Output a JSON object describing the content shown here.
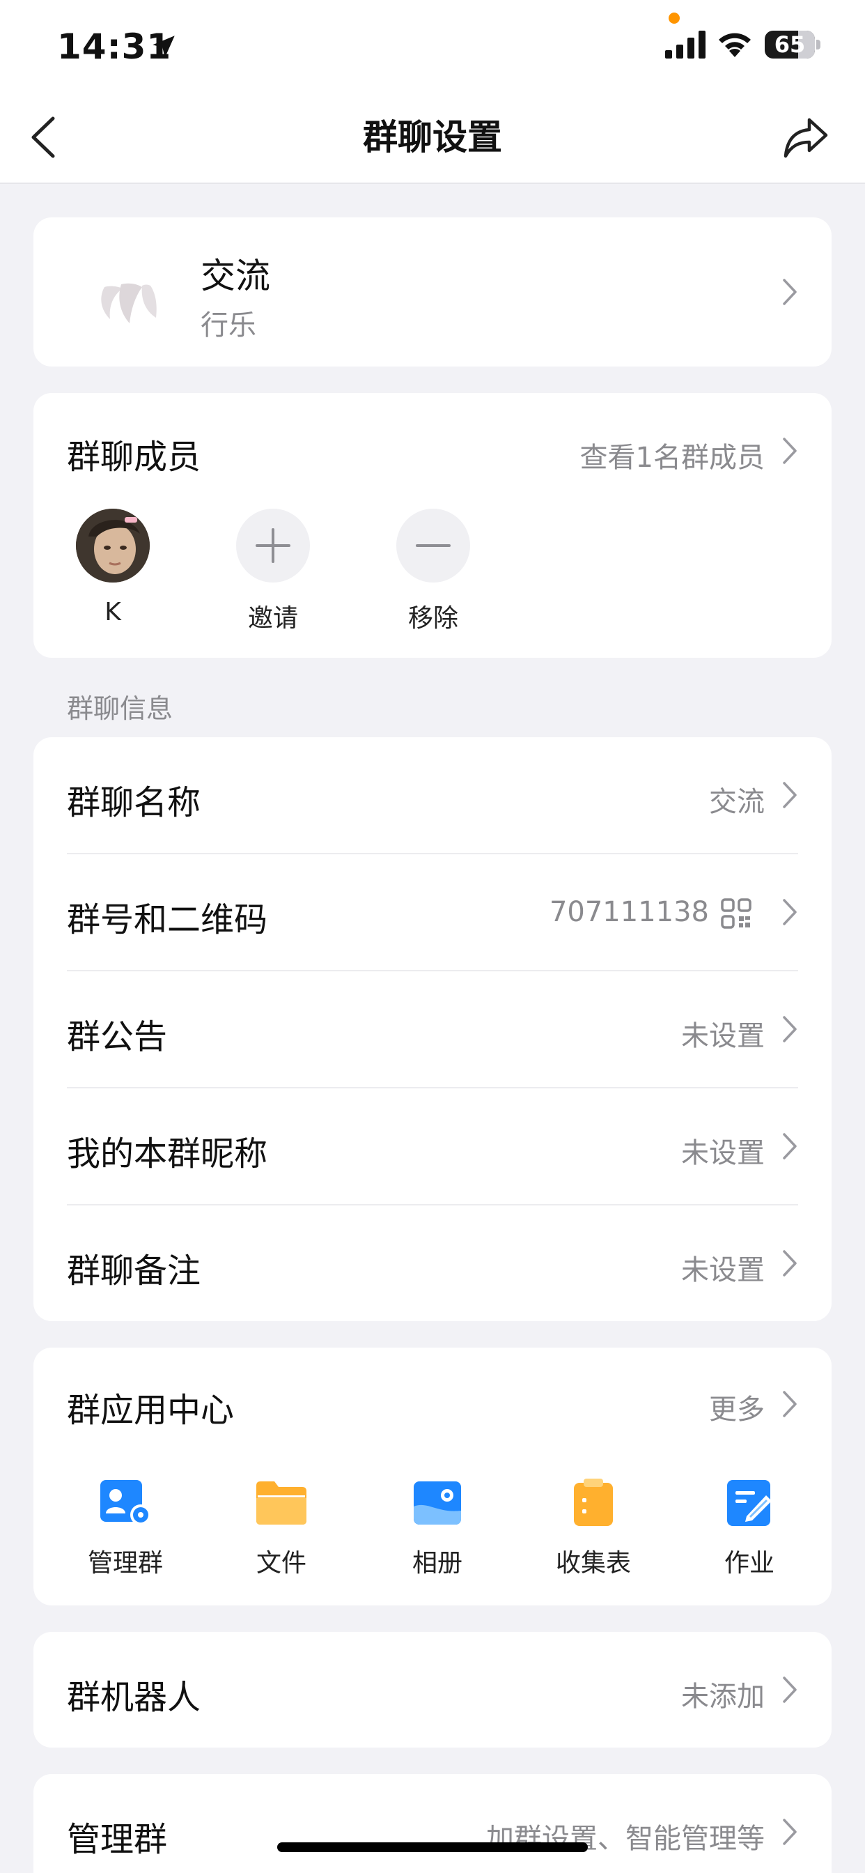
{
  "status_bar": {
    "time": "14:31",
    "battery": "65"
  },
  "nav": {
    "title": "群聊设置"
  },
  "group": {
    "name": "交流",
    "subtitle": "行乐"
  },
  "members": {
    "title": "群聊成员",
    "view_all": "查看1名群成员",
    "items": [
      {
        "name": "K"
      },
      {
        "name": "邀请"
      },
      {
        "name": "移除"
      }
    ]
  },
  "info_section": {
    "title": "群聊信息",
    "rows": [
      {
        "label": "群聊名称",
        "value": "交流"
      },
      {
        "label": "群号和二维码",
        "value": "707111138"
      },
      {
        "label": "群公告",
        "value": "未设置"
      },
      {
        "label": "我的本群昵称",
        "value": "未设置"
      },
      {
        "label": "群聊备注",
        "value": "未设置"
      }
    ]
  },
  "apps": {
    "title": "群应用中心",
    "more": "更多",
    "items": [
      {
        "label": "管理群",
        "icon": "manage-group-icon",
        "color": "#1e87ff"
      },
      {
        "label": "文件",
        "icon": "folder-icon",
        "color": "#ffb02e"
      },
      {
        "label": "相册",
        "icon": "album-icon",
        "color": "#1e87ff"
      },
      {
        "label": "收集表",
        "icon": "form-icon",
        "color": "#ffb02e"
      },
      {
        "label": "作业",
        "icon": "homework-icon",
        "color": "#1e87ff"
      }
    ]
  },
  "robot": {
    "label": "群机器人",
    "value": "未添加"
  },
  "manage": {
    "label": "管理群",
    "value": "加群设置、智能管理等"
  }
}
